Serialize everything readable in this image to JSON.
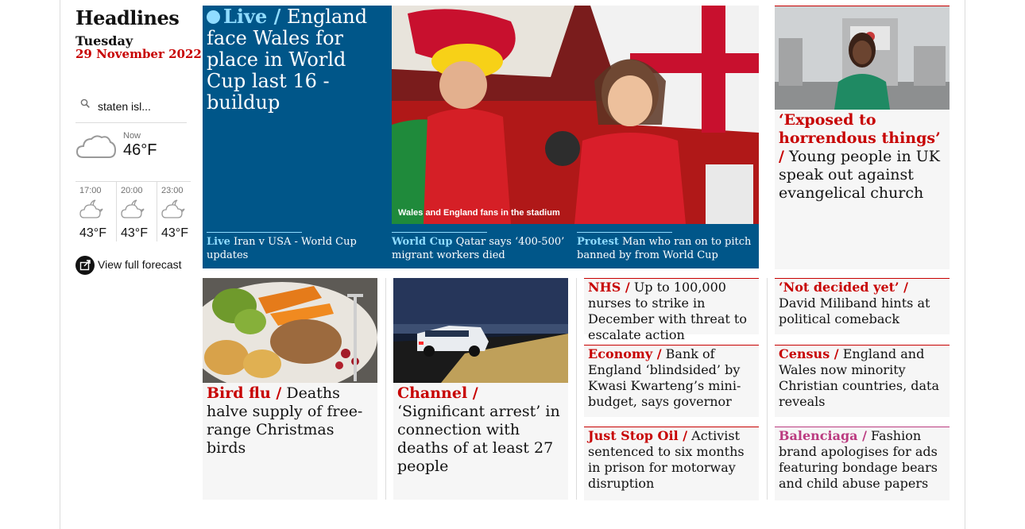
{
  "sidebar": {
    "title": "Headlines",
    "day": "Tuesday",
    "date": "29 November 2022",
    "location": "staten isl...",
    "weather": {
      "now_label": "Now",
      "now_temp": "46°F",
      "forecast": [
        {
          "time": "17:00",
          "temp": "43°F",
          "icon": "partly-cloudy-night-icon"
        },
        {
          "time": "20:00",
          "temp": "43°F",
          "icon": "partly-cloudy-night-icon"
        },
        {
          "time": "23:00",
          "temp": "43°F",
          "icon": "partly-cloudy-night-icon"
        }
      ],
      "forecast_link": "View full forecast"
    }
  },
  "hero": {
    "kicker": "Live /",
    "headline": "England face Wales for place in World Cup last 16 - buildup",
    "image_caption": "Wales and England fans in the stadium",
    "sublinks": [
      {
        "kicker": "Live",
        "text": "Iran v USA - World Cup updates"
      },
      {
        "kicker": "World Cup",
        "text": "Qatar says ‘400-500’ migrant workers died"
      },
      {
        "kicker": "Protest",
        "text": "Man who ran on to pitch banned by from World Cup"
      }
    ]
  },
  "cards": {
    "church": {
      "kicker": "‘Exposed to horrendous things’ /",
      "text": "Young people in UK speak out against evangelical church"
    },
    "birdflu": {
      "kicker": "Bird flu /",
      "text": "Deaths halve supply of free-range Christmas birds"
    },
    "channel": {
      "kicker": "Channel /",
      "text": "‘Significant arrest’ in connection with deaths of at least 27 people"
    },
    "nhs": {
      "kicker": "NHS /",
      "text": "Up to 100,000 nurses to strike in December with threat to escalate action"
    },
    "economy": {
      "kicker": "Economy /",
      "text": "Bank of England ‘blindsided’ by Kwasi Kwarteng’s mini-budget, says governor"
    },
    "juststop": {
      "kicker": "Just Stop Oil /",
      "text": "Activist sentenced to six months in prison for motorway disruption"
    },
    "miliband": {
      "kicker": "‘Not decided yet’ /",
      "text": "David Miliband hints at political comeback"
    },
    "census": {
      "kicker": "Census /",
      "text": "England and Wales now minority Christian countries, data reveals"
    },
    "balenciaga": {
      "kicker": "Balenciaga /",
      "text": "Fashion brand apologises for ads featuring bondage bears and child abuse papers"
    }
  },
  "colors": {
    "news_red": "#c70000",
    "live_blue": "#005689",
    "live_accent": "#90dcff",
    "lifestyle_pink": "#bb3b80",
    "card_bg": "#f6f6f6"
  }
}
